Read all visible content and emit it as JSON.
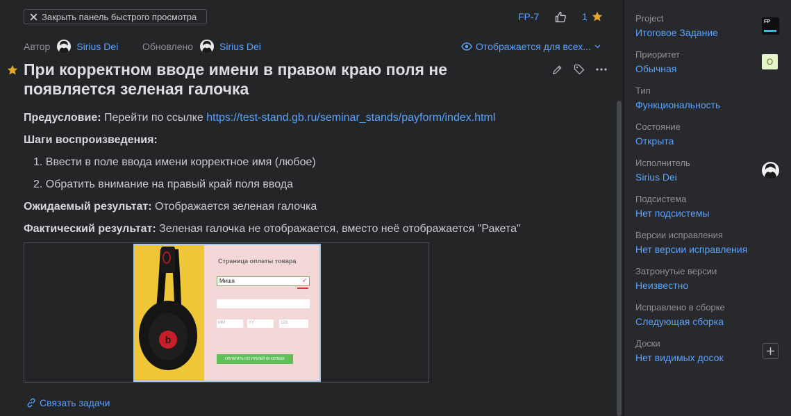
{
  "header": {
    "close_panel_label": "Закрыть панель быстрого просмотра",
    "issue_id": "FP-7",
    "favorites_count": "1"
  },
  "meta": {
    "author_label": "Автор",
    "author_name": "Sirius Dei",
    "updated_label": "Обновлено",
    "updated_name": "Sirius Dei",
    "visibility": "Отображается для всех..."
  },
  "issue": {
    "title": "При корректном вводе имени в правом краю поля не появляется зеленая галочка",
    "precondition_label": "Предусловие:",
    "precondition_text": "Перейти по ссылке",
    "precondition_url": "https://test-stand.gb.ru/seminar_stands/payform/index.html",
    "steps_label": "Шаги воспроизведения:",
    "steps": [
      "1. Ввести в поле ввода имени корректное имя (любое)",
      "2. Обратить внимание на правый край поля ввода"
    ],
    "expected_label": "Ожидаемый результат:",
    "expected_text": "Отображается зеленая галочка",
    "actual_label": "Фактический результат:",
    "actual_text": "Зеленая галочка не отображается, вместо неё отображается \"Ракета\""
  },
  "screenshot": {
    "form_title": "Страница оплаты товара",
    "name_value": "Миша",
    "mm": "MM",
    "yy": "YY",
    "cvc": "123",
    "pay_button": "ОПЛАТИТЬ 672 РУБЛЕЙ 00 КОПЕЕК"
  },
  "footer": {
    "link_tasks": "Связать задачи"
  },
  "sidebar": {
    "project_label": "Project",
    "project_value": "Итоговое Задание",
    "project_badge": "FP",
    "priority_label": "Приоритет",
    "priority_value": "Обычная",
    "priority_badge": "O",
    "type_label": "Тип",
    "type_value": "Функциональность",
    "state_label": "Состояние",
    "state_value": "Открыта",
    "assignee_label": "Исполнитель",
    "assignee_value": "Sirius Dei",
    "subsystem_label": "Подсистема",
    "subsystem_value": "Нет подсистемы",
    "fix_versions_label": "Версии исправления",
    "fix_versions_value": "Нет версии исправления",
    "affected_versions_label": "Затронутые версии",
    "affected_versions_value": "Неизвестно",
    "fixed_in_build_label": "Исправлено в сборке",
    "fixed_in_build_value": "Следующая сборка",
    "boards_label": "Доски",
    "boards_value": "Нет видимых досок"
  },
  "colors": {
    "accent": "#5aa2ff",
    "star": "#e3a82b",
    "background": "#242527",
    "sidebar_bg": "#27292c"
  }
}
